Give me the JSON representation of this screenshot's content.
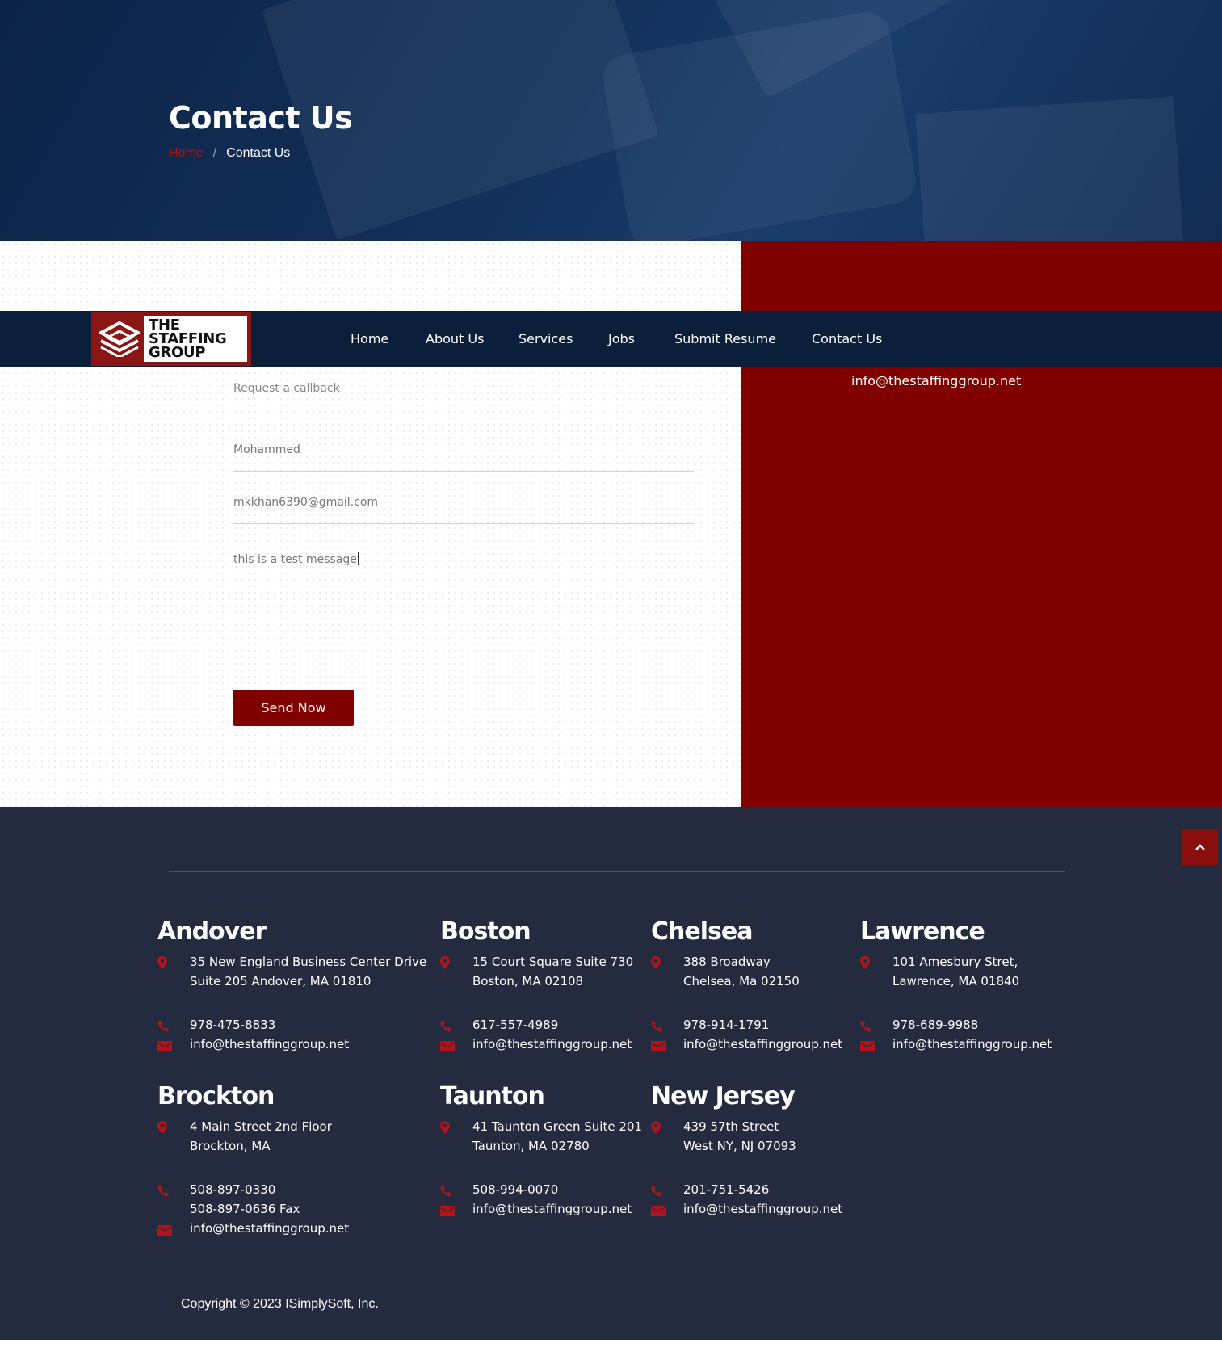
{
  "hero": {
    "title": "Contact Us",
    "breadcrumb_home": "Home",
    "breadcrumb_sep": "/",
    "breadcrumb_current": "Contact Us"
  },
  "nav": {
    "logo_lines": [
      "THE",
      "STAFFING",
      "GROUP"
    ],
    "items": [
      "Home",
      "About Us",
      "Services",
      "Jobs",
      "Submit Resume",
      "Contact Us"
    ]
  },
  "contact": {
    "email": "info@thestaffinggroup.net"
  },
  "form": {
    "label": "Request a callback",
    "name_value": "Mohammed",
    "email_value": "mkkhan6390@gmail.com",
    "message_value": "this is a test message",
    "submit_label": "Send Now"
  },
  "offices": [
    {
      "name": "Andover",
      "address": [
        "35 New England Business Center Drive",
        "Suite 205 Andover, MA 01810"
      ],
      "phones": [
        "978-475-8833"
      ],
      "email": "info@thestaffinggroup.net"
    },
    {
      "name": "Boston",
      "address": [
        "15 Court Square Suite 730",
        "Boston, MA 02108"
      ],
      "phones": [
        "617-557-4989"
      ],
      "email": "info@thestaffinggroup.net"
    },
    {
      "name": "Chelsea",
      "address": [
        "388 Broadway",
        "Chelsea, Ma 02150"
      ],
      "phones": [
        "978-914-1791"
      ],
      "email": "info@thestaffinggroup.net"
    },
    {
      "name": "Lawrence",
      "address": [
        "101 Amesbury Stret,",
        "Lawrence, MA 01840"
      ],
      "phones": [
        "978-689-9988"
      ],
      "email": "info@thestaffinggroup.net"
    },
    {
      "name": "Brockton",
      "address": [
        "4 Main Street 2nd Floor",
        "Brockton, MA"
      ],
      "phones": [
        "508-897-0330",
        "508-897-0636 Fax"
      ],
      "email": "info@thestaffinggroup.net"
    },
    {
      "name": "Taunton",
      "address": [
        "41 Taunton Green Suite 201",
        "Taunton, MA 02780"
      ],
      "phones": [
        "508-994-0070"
      ],
      "email": "info@thestaffinggroup.net"
    },
    {
      "name": "New Jersey",
      "address": [
        "439 57th Street",
        "West NY, NJ 07093"
      ],
      "phones": [
        "201-751-5426"
      ],
      "email": "info@thestaffinggroup.net"
    }
  ],
  "footer": {
    "copyright": "Copyright © 2023 ISimplySoft, Inc."
  },
  "icons": {
    "address": "map-pin-icon",
    "phone": "phone-icon",
    "email": "envelope-icon",
    "scroll": "chevron-up-icon"
  },
  "colors": {
    "brand_red": "#800000",
    "navy": "#0b1e3a",
    "footer_bg": "#252b3f",
    "icon_red": "#b3121a"
  }
}
